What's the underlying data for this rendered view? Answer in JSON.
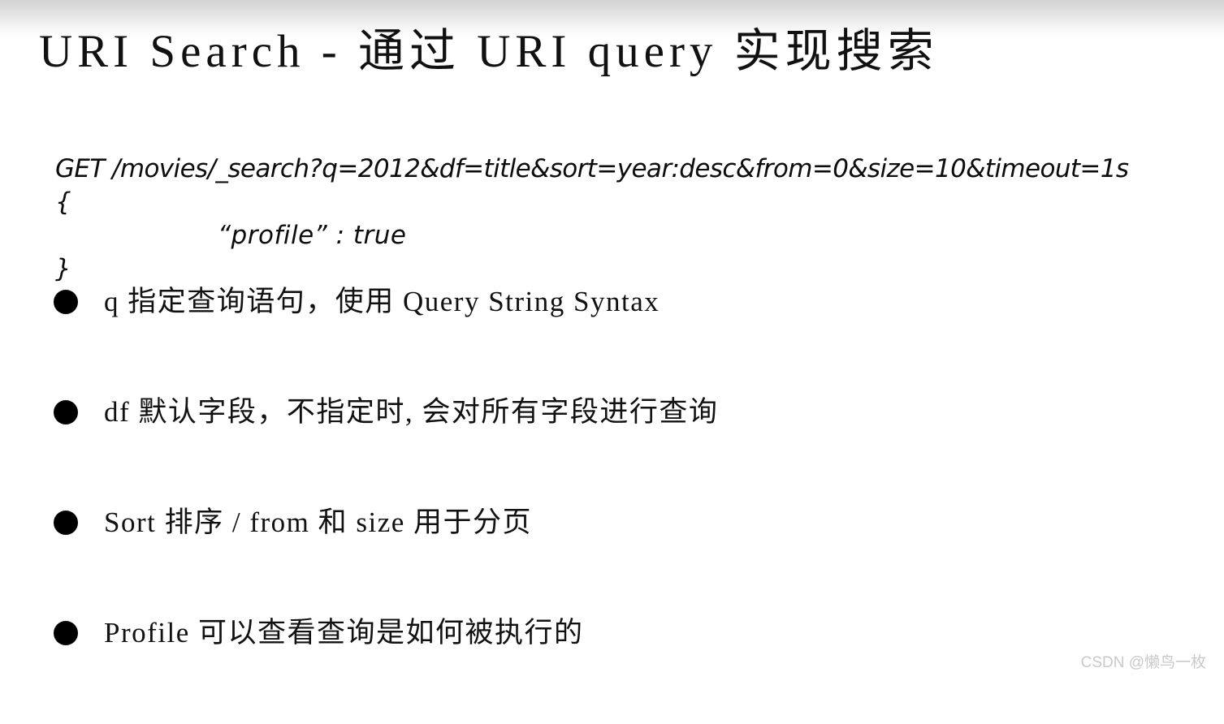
{
  "slide": {
    "background_color": "#ffffff",
    "text_color": "#111111",
    "title": "URI Search - 通过 URI query 实现搜索"
  },
  "code": {
    "lines": [
      "GET /movies/_search?q=2012&df=title&sort=year:desc&from=0&size=10&timeout=1s",
      "{",
      "“profile” : true",
      "}"
    ],
    "request_line": "GET /movies/_search?q=2012&df=title&sort=year:desc&from=0&size=10&timeout=1s",
    "brace_open": "{",
    "body": "“profile” : true",
    "brace_close": "}"
  },
  "bullets": [
    {
      "marker": "bullet-dot",
      "text": "q 指定查询语句，使用 Query String Syntax"
    },
    {
      "marker": "bullet-dot",
      "text": "df 默认字段，不指定时, 会对所有字段进行查询"
    },
    {
      "marker": "bullet-dot",
      "text": "Sort 排序 / from 和 size 用于分页"
    },
    {
      "marker": "bullet-dot",
      "text": "Profile 可以查看查询是如何被执行的"
    }
  ],
  "watermark": {
    "text": "CSDN @懒鸟一枚",
    "color": "#c9c9c9"
  }
}
